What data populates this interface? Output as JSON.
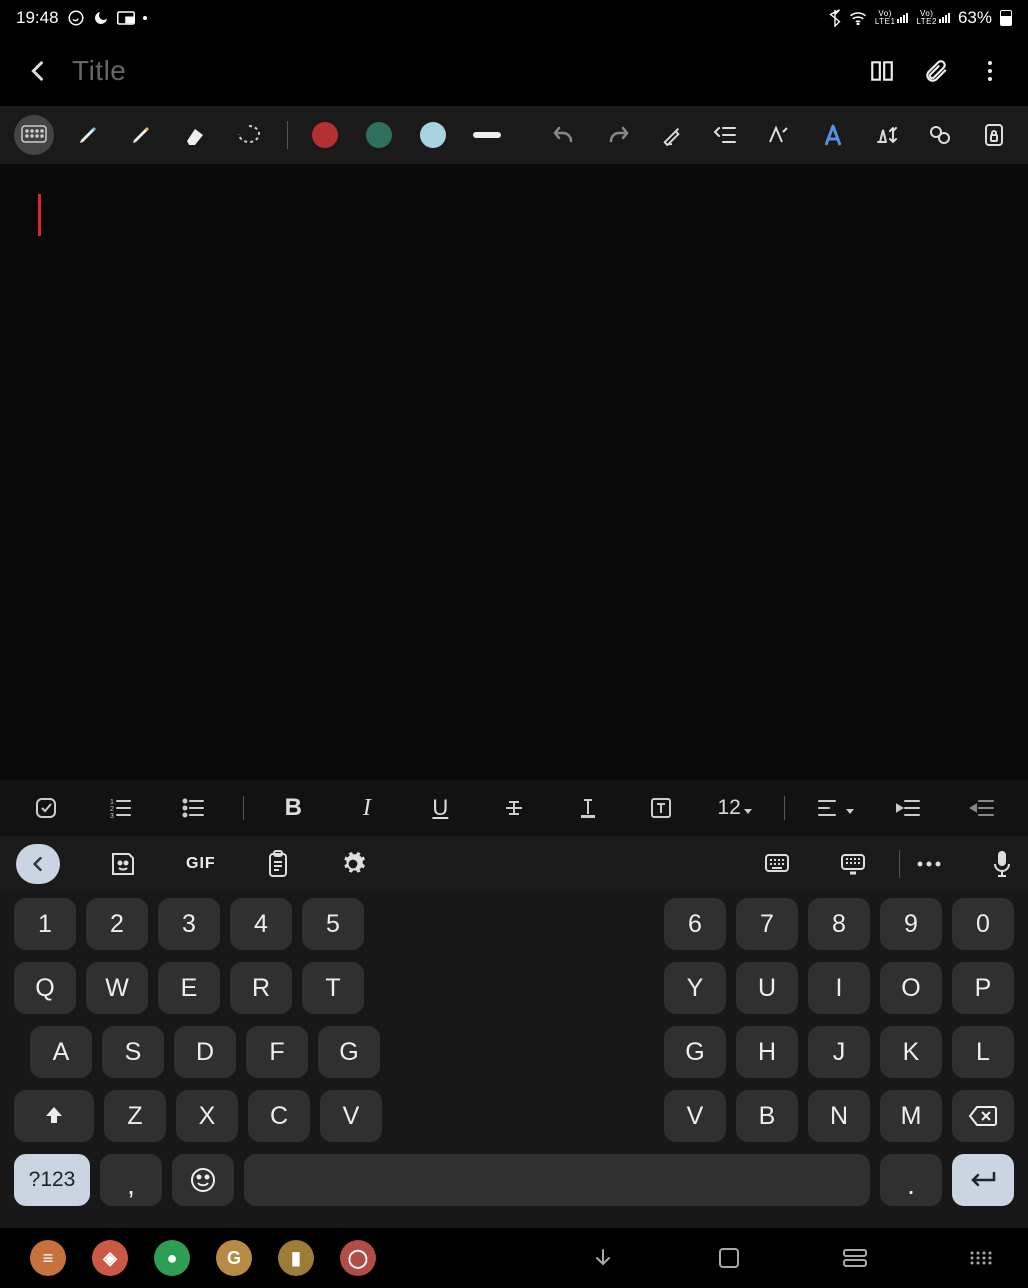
{
  "status": {
    "time": "19:48",
    "lte1": "LTE1",
    "lte2": "LTE2",
    "battery": "63%",
    "volte": "Vo)"
  },
  "header": {
    "title_placeholder": "Title"
  },
  "draw_tools": {
    "colors": [
      "#b53030",
      "#2f6f5d",
      "#a7d3df"
    ]
  },
  "richtext": {
    "font_size": "12"
  },
  "kb_toolbar": {
    "gif_label": "GIF"
  },
  "keyboard": {
    "rows": {
      "num_left": [
        "1",
        "2",
        "3",
        "4",
        "5"
      ],
      "num_right": [
        "6",
        "7",
        "8",
        "9",
        "0"
      ],
      "top_left": [
        "Q",
        "W",
        "E",
        "R",
        "T"
      ],
      "top_right": [
        "Y",
        "U",
        "I",
        "O",
        "P"
      ],
      "mid_left": [
        "A",
        "S",
        "D",
        "F",
        "G"
      ],
      "mid_right": [
        "G",
        "H",
        "J",
        "K",
        "L"
      ],
      "bot_left": [
        "Z",
        "X",
        "C",
        "V"
      ],
      "bot_right": [
        "V",
        "B",
        "N",
        "M"
      ]
    },
    "symbols": "?123",
    "comma": ",",
    "period": "."
  },
  "dock": {
    "apps": [
      {
        "color": "#c7713e",
        "glyph": "≡"
      },
      {
        "color": "#ca5a46",
        "glyph": "◈"
      },
      {
        "color": "#2f9e55",
        "glyph": "●"
      },
      {
        "color": "#b78b44",
        "glyph": "G"
      },
      {
        "color": "#9d7c38",
        "glyph": "▮"
      },
      {
        "color": "#b14c46",
        "glyph": "◯"
      }
    ]
  }
}
